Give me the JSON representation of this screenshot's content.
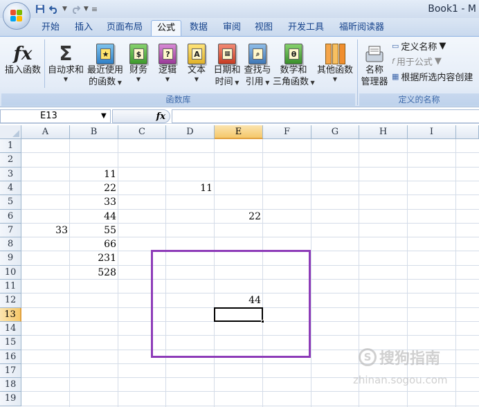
{
  "window": {
    "title": "Book1 - M"
  },
  "tabs": [
    "开始",
    "插入",
    "页面布局",
    "公式",
    "数据",
    "审阅",
    "视图",
    "开发工具",
    "福昕阅读器"
  ],
  "active_tab": "公式",
  "ribbon": {
    "function_library": {
      "label": "函数库",
      "insert_function": "插入函数",
      "autosum": "自动求和",
      "recent_l1": "最近使用",
      "recent_l2": "的函数",
      "financial": "财务",
      "logical": "逻辑",
      "text": "文本",
      "datetime_l1": "日期和",
      "datetime_l2": "时间",
      "lookup_l1": "查找与",
      "lookup_l2": "引用",
      "math_l1": "数学和",
      "math_l2": "三角函数",
      "more": "其他函数",
      "icon_text_fx": "fx",
      "icon_text_sigma": "Σ",
      "icon_text_logical": "?",
      "icon_text_text": "A",
      "icon_text_math": "θ"
    },
    "defined_names": {
      "label": "定义的名称",
      "name_manager_l1": "名称",
      "name_manager_l2": "管理器",
      "define_name": "定义名称",
      "use_in_formula": "用于公式",
      "create_from_selection": "根据所选内容创建"
    }
  },
  "formula_bar": {
    "name_box": "E13",
    "fx_label": "fx",
    "formula": ""
  },
  "columns": [
    "A",
    "B",
    "C",
    "D",
    "E",
    "F",
    "G",
    "H",
    "I"
  ],
  "rows": [
    "1",
    "2",
    "3",
    "4",
    "5",
    "6",
    "7",
    "8",
    "9",
    "10",
    "11",
    "12",
    "13",
    "14",
    "15",
    "16",
    "17",
    "18",
    "19"
  ],
  "cells": [
    {
      "ref": "B3",
      "value": "11"
    },
    {
      "ref": "B4",
      "value": "22"
    },
    {
      "ref": "D4",
      "value": "11"
    },
    {
      "ref": "B5",
      "value": "33"
    },
    {
      "ref": "B6",
      "value": "44"
    },
    {
      "ref": "E6",
      "value": "22"
    },
    {
      "ref": "A7",
      "value": "33"
    },
    {
      "ref": "B7",
      "value": "55"
    },
    {
      "ref": "B8",
      "value": "66"
    },
    {
      "ref": "B9",
      "value": "231"
    },
    {
      "ref": "B10",
      "value": "528"
    },
    {
      "ref": "E12",
      "value": "44"
    }
  ],
  "selected_cell": "E13",
  "watermark": {
    "text": "搜狗指南",
    "logo": "S",
    "url": "zhinan.sogou.com"
  },
  "colors": {
    "highlight_box": "#8d3bb8",
    "selection_header": "#f5c86a",
    "ribbon_text": "#15428b"
  }
}
